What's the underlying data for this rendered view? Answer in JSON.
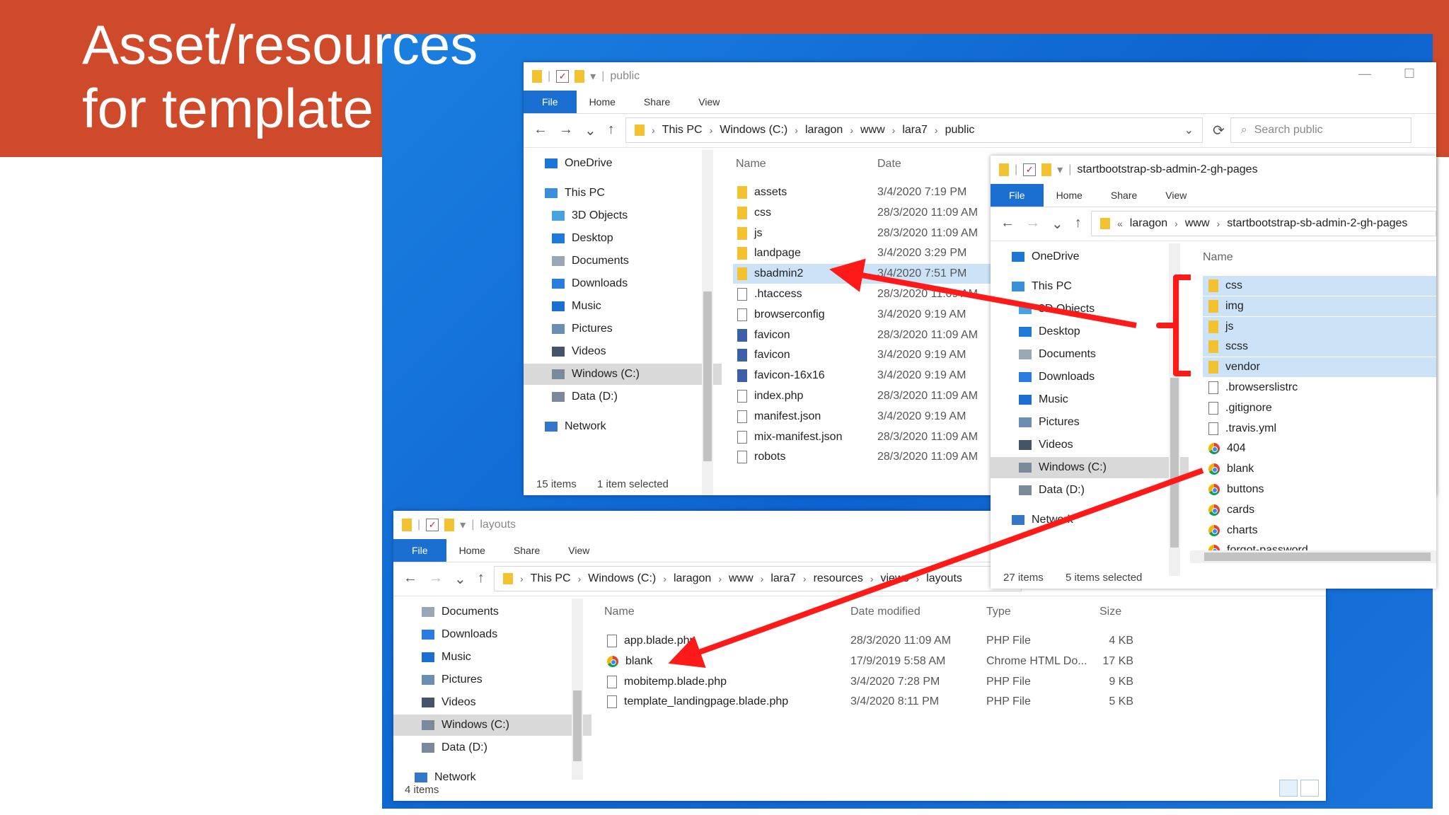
{
  "slide": {
    "title_line1": "Asset/resources",
    "title_line2": "for template",
    "colors": {
      "banner": "#cf4a2a",
      "desktop": "#1473d8",
      "arrow": "#ff1a1a",
      "selection": "#cce3f7",
      "file_tab": "#1a6fd1"
    }
  },
  "quick_access": {
    "separator": "|",
    "dropdown": "▾"
  },
  "ribbon_common": {
    "file": "File",
    "home": "Home",
    "share": "Share",
    "view": "View"
  },
  "nav_common": {
    "back": "←",
    "forward": "→",
    "recent": "⌄",
    "up": "↑",
    "refresh": "⟳",
    "sep": "›",
    "chev": "⌄"
  },
  "win_public": {
    "title": "public",
    "crumbs": [
      "This PC",
      "Windows (C:)",
      "laragon",
      "www",
      "lara7",
      "public"
    ],
    "search_placeholder": "Search public",
    "header_name": "Name",
    "header_date": "Date",
    "nav": [
      {
        "label": "OneDrive",
        "icon": "onedrive-icon"
      },
      {
        "label": "This PC",
        "icon": "this-pc-icon"
      },
      {
        "label": "3D Objects",
        "icon": "3d-objects-icon"
      },
      {
        "label": "Desktop",
        "icon": "desktop-icon"
      },
      {
        "label": "Documents",
        "icon": "documents-icon"
      },
      {
        "label": "Downloads",
        "icon": "downloads-icon"
      },
      {
        "label": "Music",
        "icon": "music-icon"
      },
      {
        "label": "Pictures",
        "icon": "pictures-icon"
      },
      {
        "label": "Videos",
        "icon": "videos-icon"
      },
      {
        "label": "Windows (C:)",
        "icon": "drive-icon"
      },
      {
        "label": "Data (D:)",
        "icon": "drive-icon"
      },
      {
        "label": "Network",
        "icon": "network-icon"
      }
    ],
    "files": [
      {
        "name": "assets",
        "date": "3/4/2020 7:19 PM",
        "kind": "folder"
      },
      {
        "name": "css",
        "date": "28/3/2020 11:09 AM",
        "kind": "folder"
      },
      {
        "name": "js",
        "date": "28/3/2020 11:09 AM",
        "kind": "folder"
      },
      {
        "name": "landpage",
        "date": "3/4/2020 3:29 PM",
        "kind": "folder"
      },
      {
        "name": "sbadmin2",
        "date": "3/4/2020 7:51 PM",
        "kind": "folder"
      },
      {
        "name": ".htaccess",
        "date": "28/3/2020 11:09 AM",
        "kind": "doc"
      },
      {
        "name": "browserconfig",
        "date": "3/4/2020 9:19 AM",
        "kind": "doc"
      },
      {
        "name": "favicon",
        "date": "28/3/2020 11:09 AM",
        "kind": "img"
      },
      {
        "name": "favicon",
        "date": "3/4/2020 9:19 AM",
        "kind": "img"
      },
      {
        "name": "favicon-16x16",
        "date": "3/4/2020 9:19 AM",
        "kind": "img"
      },
      {
        "name": "index.php",
        "date": "28/3/2020 11:09 AM",
        "kind": "doc"
      },
      {
        "name": "manifest.json",
        "date": "3/4/2020 9:19 AM",
        "kind": "doc"
      },
      {
        "name": "mix-manifest.json",
        "date": "28/3/2020 11:09 AM",
        "kind": "doc"
      },
      {
        "name": "robots",
        "date": "28/3/2020 11:09 AM",
        "kind": "doc"
      }
    ],
    "status_items": "15 items",
    "status_selected": "1 item selected"
  },
  "win_sb": {
    "title": "startbootstrap-sb-admin-2-gh-pages",
    "crumbs_prefix": "«",
    "crumbs": [
      "laragon",
      "www",
      "startbootstrap-sb-admin-2-gh-pages"
    ],
    "header_name": "Name",
    "nav": [
      {
        "label": "OneDrive",
        "icon": "onedrive-icon"
      },
      {
        "label": "This PC",
        "icon": "this-pc-icon"
      },
      {
        "label": "3D Objects",
        "icon": "3d-objects-icon"
      },
      {
        "label": "Desktop",
        "icon": "desktop-icon"
      },
      {
        "label": "Documents",
        "icon": "documents-icon"
      },
      {
        "label": "Downloads",
        "icon": "downloads-icon"
      },
      {
        "label": "Music",
        "icon": "music-icon"
      },
      {
        "label": "Pictures",
        "icon": "pictures-icon"
      },
      {
        "label": "Videos",
        "icon": "videos-icon"
      },
      {
        "label": "Windows (C:)",
        "icon": "drive-icon"
      },
      {
        "label": "Data (D:)",
        "icon": "drive-icon"
      },
      {
        "label": "Network",
        "icon": "network-icon"
      }
    ],
    "files": [
      {
        "name": "css",
        "kind": "folder",
        "selected": true
      },
      {
        "name": "img",
        "kind": "folder",
        "selected": true
      },
      {
        "name": "js",
        "kind": "folder",
        "selected": true
      },
      {
        "name": "scss",
        "kind": "folder",
        "selected": true
      },
      {
        "name": "vendor",
        "kind": "folder",
        "selected": true
      },
      {
        "name": ".browserslistrc",
        "kind": "doc",
        "selected": false
      },
      {
        "name": ".gitignore",
        "kind": "doc",
        "selected": false
      },
      {
        "name": ".travis.yml",
        "kind": "doc",
        "selected": false
      },
      {
        "name": "404",
        "kind": "chrome",
        "selected": false
      },
      {
        "name": "blank",
        "kind": "chrome",
        "selected": false
      },
      {
        "name": "buttons",
        "kind": "chrome",
        "selected": false
      },
      {
        "name": "cards",
        "kind": "chrome",
        "selected": false
      },
      {
        "name": "charts",
        "kind": "chrome",
        "selected": false
      },
      {
        "name": "forgot-password",
        "kind": "chrome",
        "selected": false
      }
    ],
    "status_items": "27 items",
    "status_selected": "5 items selected"
  },
  "win_layouts": {
    "title": "layouts",
    "crumbs": [
      "This PC",
      "Windows (C:)",
      "laragon",
      "www",
      "lara7",
      "resources",
      "views",
      "layouts"
    ],
    "headers": {
      "name": "Name",
      "date": "Date modified",
      "type": "Type",
      "size": "Size"
    },
    "nav": [
      {
        "label": "Documents",
        "icon": "documents-icon"
      },
      {
        "label": "Downloads",
        "icon": "downloads-icon"
      },
      {
        "label": "Music",
        "icon": "music-icon"
      },
      {
        "label": "Pictures",
        "icon": "pictures-icon"
      },
      {
        "label": "Videos",
        "icon": "videos-icon"
      },
      {
        "label": "Windows (C:)",
        "icon": "drive-icon"
      },
      {
        "label": "Data (D:)",
        "icon": "drive-icon"
      },
      {
        "label": "Network",
        "icon": "network-icon"
      }
    ],
    "files": [
      {
        "name": "app.blade.php",
        "date": "28/3/2020 11:09 AM",
        "type": "PHP File",
        "size": "4 KB",
        "kind": "doc"
      },
      {
        "name": "blank",
        "date": "17/9/2019 5:58 AM",
        "type": "Chrome HTML Do...",
        "size": "17 KB",
        "kind": "chrome"
      },
      {
        "name": "mobitemp.blade.php",
        "date": "3/4/2020 7:28 PM",
        "type": "PHP File",
        "size": "9 KB",
        "kind": "doc"
      },
      {
        "name": "template_landingpage.blade.php",
        "date": "3/4/2020 8:11 PM",
        "type": "PHP File",
        "size": "5 KB",
        "kind": "doc"
      }
    ],
    "status_items": "4 items"
  }
}
